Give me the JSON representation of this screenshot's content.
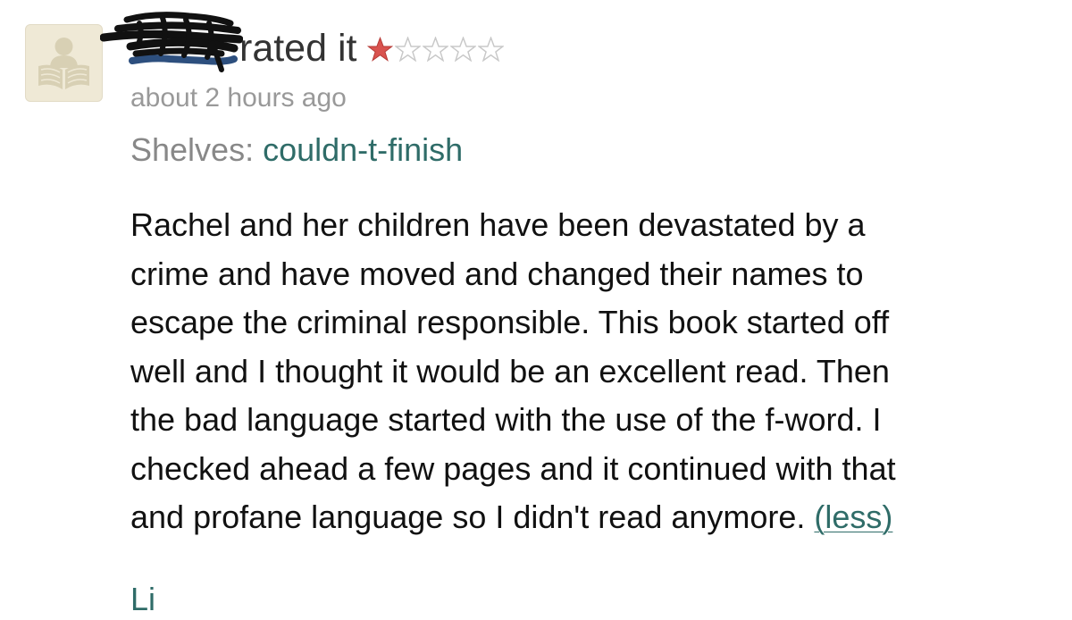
{
  "review": {
    "rated_text": "rated it",
    "rating": 1,
    "max_rating": 5,
    "timestamp": "about 2 hours ago",
    "shelves_label": "Shelves:",
    "shelf_name": "couldn-t-finish",
    "body_lines": [
      "Rachel and her children have been devastated by a",
      "crime and have moved and changed their names to",
      "escape the criminal responsible. This book started off",
      "well and I thought it would be an excellent read. Then",
      "the bad language started with the use of the f-word. I",
      "checked ahead a few pages and it continued with that",
      "and profane language so I didn't read anymore."
    ],
    "less_link": "(less)",
    "cutoff_text": "Li"
  },
  "icons": {
    "avatar": "default-reader-avatar-icon",
    "star_filled": "star-filled-icon",
    "star_empty": "star-empty-icon"
  },
  "colors": {
    "star_filled": "#d9534f",
    "star_empty": "#c8c8c8",
    "link": "#2f6c68",
    "muted": "#999999",
    "avatar_bg": "#efe9d6",
    "avatar_fg": "#d8d0b4"
  }
}
